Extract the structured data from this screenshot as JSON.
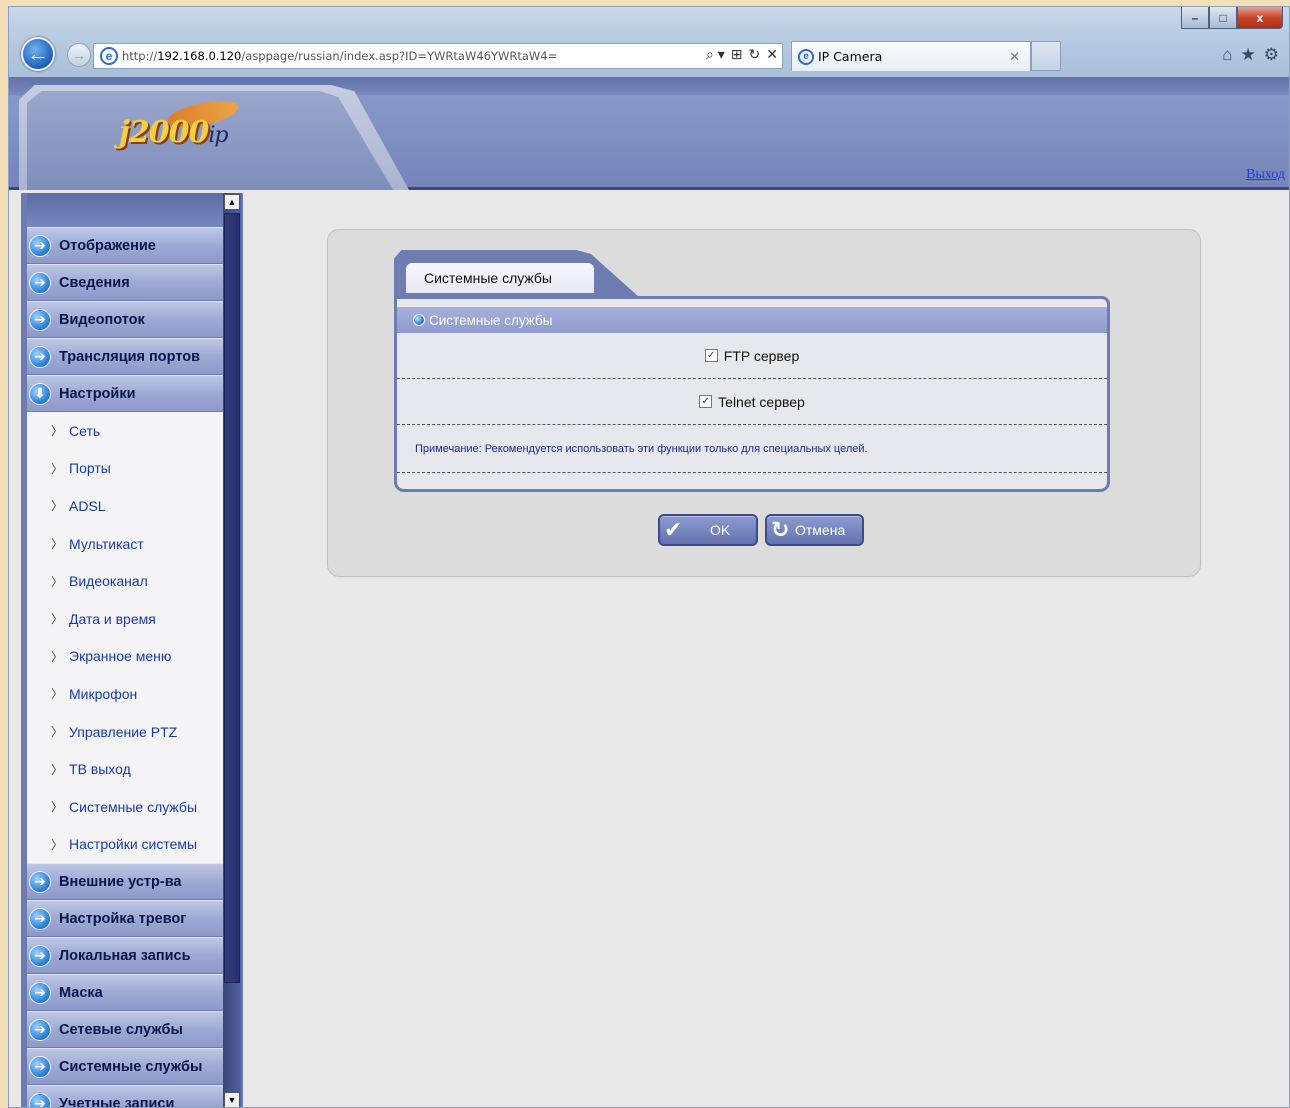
{
  "browser": {
    "url_prefix": "http://",
    "url_host": "192.168.0.120",
    "url_path": "/asppage/russian/index.asp?ID=YWRtaW46YWRtaW4=",
    "tab_title": "IP Camera",
    "window_buttons": {
      "minimize": "–",
      "maximize": "□",
      "close": "x"
    },
    "address_tools": [
      "⌕ ▾",
      "⊞",
      "↻",
      "✕"
    ],
    "toolbar_icons": [
      "home-icon",
      "star-icon",
      "gear-icon"
    ]
  },
  "header": {
    "logo_text": "j2000",
    "logo_suffix": "ip",
    "logout_label": "Выход"
  },
  "sidebar": {
    "main_top": [
      {
        "label": "Отображение"
      },
      {
        "label": "Сведения"
      },
      {
        "label": "Видеопоток"
      },
      {
        "label": "Трансляция портов"
      }
    ],
    "expanded": {
      "label": "Настройки"
    },
    "sub_items": [
      {
        "label": "Сеть"
      },
      {
        "label": "Порты"
      },
      {
        "label": "ADSL"
      },
      {
        "label": "Мультикаст"
      },
      {
        "label": "Видеоканал"
      },
      {
        "label": "Дата и время"
      },
      {
        "label": "Экранное меню"
      },
      {
        "label": "Микрофон"
      },
      {
        "label": "Управление PTZ"
      },
      {
        "label": "ТВ выход"
      },
      {
        "label": "Системные службы"
      },
      {
        "label": "Настройки системы"
      }
    ],
    "main_bottom": [
      {
        "label": "Внешние устр-ва"
      },
      {
        "label": "Настройка тревог"
      },
      {
        "label": "Локальная запись"
      },
      {
        "label": "Маска"
      },
      {
        "label": "Сетевые службы"
      },
      {
        "label": "Системные службы"
      },
      {
        "label": "Учетные записи"
      }
    ]
  },
  "content": {
    "tab_label": "Системные службы",
    "section_header": "Системные службы",
    "options": [
      {
        "label": "FTP сервер",
        "checked": true
      },
      {
        "label": "Telnet сервер",
        "checked": true
      }
    ],
    "note": "Примечание: Рекомендуется использовать эти функции только для специальных целей.",
    "ok_label": "OK",
    "cancel_label": "Отмена"
  }
}
